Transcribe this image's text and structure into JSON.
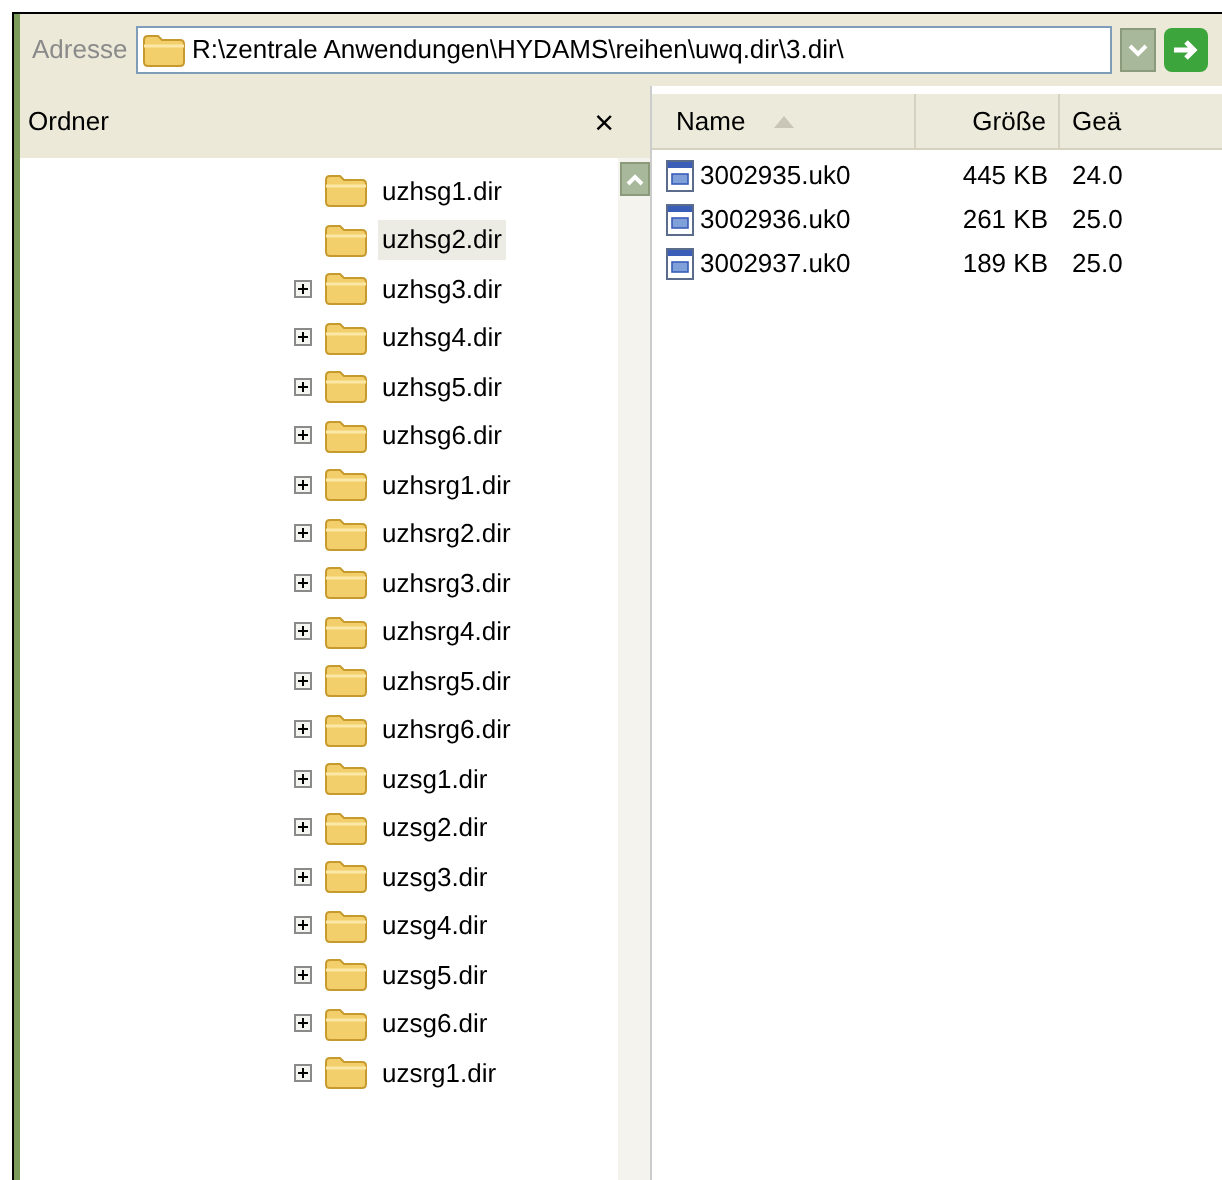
{
  "address_bar": {
    "label": "Adresse",
    "path": "R:\\zentrale Anwendungen\\HYDAMS\\reihen\\uwq.dir\\3.dir\\"
  },
  "folders_pane": {
    "title": "Ordner",
    "close": "×",
    "items": [
      {
        "name": "uzhsg1.dir",
        "expandable": false,
        "selected": false
      },
      {
        "name": "uzhsg2.dir",
        "expandable": false,
        "selected": true
      },
      {
        "name": "uzhsg3.dir",
        "expandable": true,
        "selected": false
      },
      {
        "name": "uzhsg4.dir",
        "expandable": true,
        "selected": false
      },
      {
        "name": "uzhsg5.dir",
        "expandable": true,
        "selected": false
      },
      {
        "name": "uzhsg6.dir",
        "expandable": true,
        "selected": false
      },
      {
        "name": "uzhsrg1.dir",
        "expandable": true,
        "selected": false
      },
      {
        "name": "uzhsrg2.dir",
        "expandable": true,
        "selected": false
      },
      {
        "name": "uzhsrg3.dir",
        "expandable": true,
        "selected": false
      },
      {
        "name": "uzhsrg4.dir",
        "expandable": true,
        "selected": false
      },
      {
        "name": "uzhsrg5.dir",
        "expandable": true,
        "selected": false
      },
      {
        "name": "uzhsrg6.dir",
        "expandable": true,
        "selected": false
      },
      {
        "name": "uzsg1.dir",
        "expandable": true,
        "selected": false
      },
      {
        "name": "uzsg2.dir",
        "expandable": true,
        "selected": false
      },
      {
        "name": "uzsg3.dir",
        "expandable": true,
        "selected": false
      },
      {
        "name": "uzsg4.dir",
        "expandable": true,
        "selected": false
      },
      {
        "name": "uzsg5.dir",
        "expandable": true,
        "selected": false
      },
      {
        "name": "uzsg6.dir",
        "expandable": true,
        "selected": false
      },
      {
        "name": "uzsrg1.dir",
        "expandable": true,
        "selected": false
      }
    ]
  },
  "file_list": {
    "columns": [
      "Name",
      "Größe",
      "Geä"
    ],
    "rows": [
      {
        "name": "3002935.uk0",
        "size": "445 KB",
        "column_3": "24.0"
      },
      {
        "name": "3002936.uk0",
        "size": "261 KB",
        "column_3": "25.0"
      },
      {
        "name": "3002937.uk0",
        "size": "189 KB",
        "column_3": "25.0"
      }
    ]
  }
}
